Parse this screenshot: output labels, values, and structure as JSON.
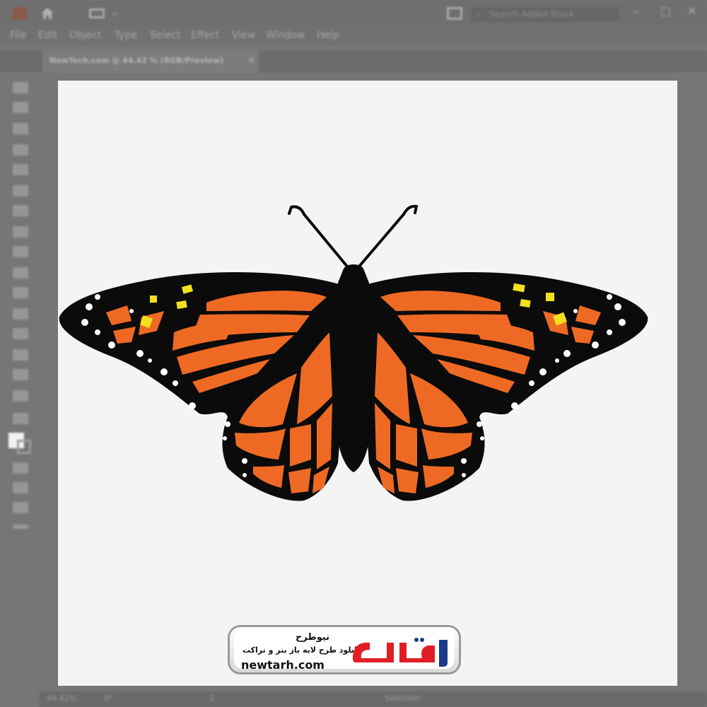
{
  "window": {
    "search_placeholder": "Search Adobe Stock",
    "window_controls": [
      "–",
      "□",
      "✕"
    ]
  },
  "menu": [
    "File",
    "Edit",
    "Object",
    "Type",
    "Select",
    "Effect",
    "View",
    "Window",
    "Help"
  ],
  "document_tab": {
    "label": "NewTech.com @ 44.42 % (RGB/Preview)",
    "close": "×"
  },
  "status_bar": {
    "zoom": "44.42%",
    "rotation": "0°",
    "artboard": "1",
    "tool_name": "Selection"
  },
  "watermark": {
    "brand_fa": "نیوطرح",
    "tagline_fa": "دانلود طرح لایه باز بنر و تراکت",
    "url": "newtarh.com",
    "logo_fa": "نیوطرح"
  },
  "colors": {
    "wing_orange": "#ee6a24",
    "body_black": "#0b0b0b",
    "spot_yellow": "#f0e11c",
    "spot_white": "#ffffff",
    "logo_red": "#e01e24",
    "logo_blue": "#1a3a8a"
  },
  "icons": [
    "home-icon",
    "layout-icon",
    "arrange-icon",
    "search-icon",
    "selection-tool-icon",
    "direct-selection-icon",
    "pen-tool-icon",
    "pencil-icon",
    "rectangle-tool-icon",
    "brush-icon",
    "type-tool-icon",
    "rotate-icon",
    "eraser-icon",
    "scale-icon",
    "width-icon",
    "eyedropper-icon",
    "blend-icon",
    "artboard-tool-icon",
    "hand-icon",
    "zoom-icon"
  ]
}
